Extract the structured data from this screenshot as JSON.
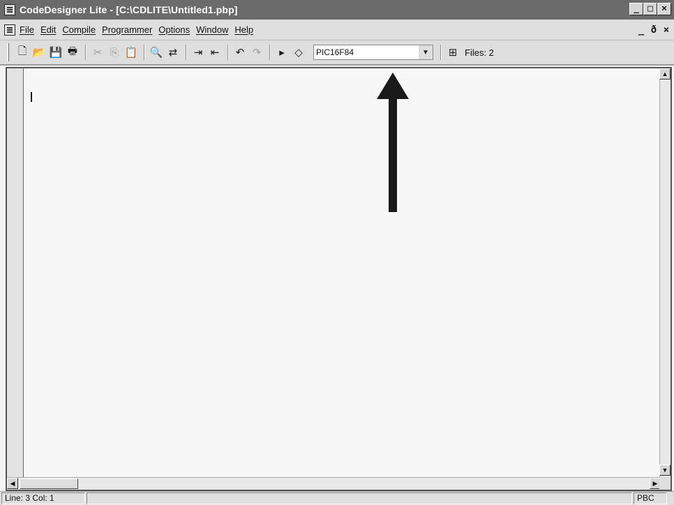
{
  "window": {
    "title": "CodeDesigner Lite - [C:\\CDLITE\\Untitled1.pbp]",
    "controls": [
      "_",
      "□",
      "×"
    ]
  },
  "menu": {
    "items": [
      "File",
      "Edit",
      "Compile",
      "Programmer",
      "Options",
      "Window",
      "Help"
    ],
    "mdi_controls": [
      "_",
      "ð",
      "×"
    ]
  },
  "toolbar": {
    "buttons": [
      {
        "icon": "new-file-icon",
        "glyph": "🗋",
        "enabled": true
      },
      {
        "icon": "open-folder-icon",
        "glyph": "📂",
        "enabled": true
      },
      {
        "icon": "save-disk-icon",
        "glyph": "💾",
        "enabled": true
      },
      {
        "icon": "printer-icon",
        "glyph": "🖶",
        "enabled": true
      },
      {
        "icon": "cut-icon",
        "glyph": "✂",
        "enabled": false
      },
      {
        "icon": "copy-icon",
        "glyph": "⎘",
        "enabled": false
      },
      {
        "icon": "paste-icon",
        "glyph": "📋",
        "enabled": false
      },
      {
        "icon": "find-binoculars-icon",
        "glyph": "🔍",
        "enabled": true
      },
      {
        "icon": "replace-icon",
        "glyph": "⇄",
        "enabled": true
      },
      {
        "icon": "indent-icon",
        "glyph": "⇥",
        "enabled": true
      },
      {
        "icon": "outdent-icon",
        "glyph": "⇤",
        "enabled": true
      },
      {
        "icon": "undo-icon",
        "glyph": "↶",
        "enabled": true
      },
      {
        "icon": "redo-icon",
        "glyph": "↷",
        "enabled": false
      },
      {
        "icon": "compile-run-icon",
        "glyph": "▸",
        "enabled": true
      },
      {
        "icon": "program-chip-icon",
        "glyph": "◇",
        "enabled": true
      }
    ],
    "device_select": "PIC16F84",
    "files_label": "Files: 2"
  },
  "status": {
    "position": "Line: 3 Col: 1",
    "language": "PBC"
  }
}
